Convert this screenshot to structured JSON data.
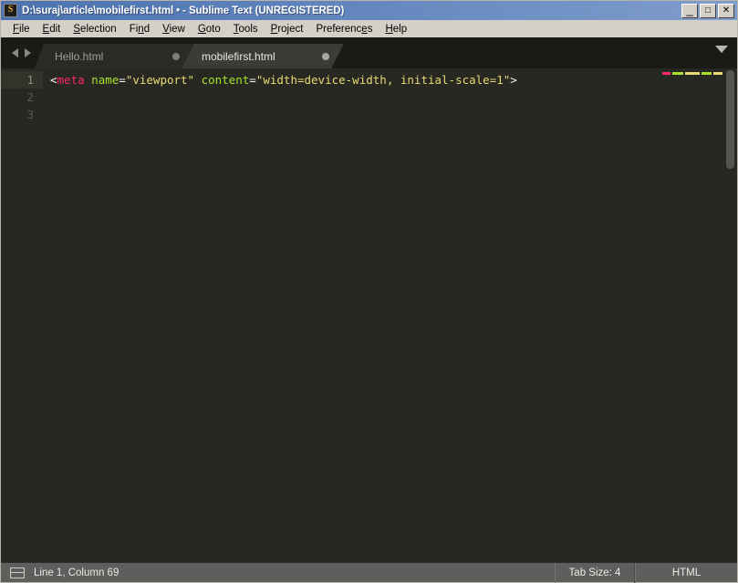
{
  "window": {
    "title": "D:\\suraj\\article\\mobilefirst.html • - Sublime Text (UNREGISTERED)",
    "app_icon": "sublime-text-icon",
    "controls": {
      "minimize": "_",
      "maximize": "□",
      "close": "✕"
    }
  },
  "menubar": {
    "items": [
      {
        "label": "File",
        "mnemonic_index": 0
      },
      {
        "label": "Edit",
        "mnemonic_index": 0
      },
      {
        "label": "Selection",
        "mnemonic_index": 0
      },
      {
        "label": "Find",
        "mnemonic_index": 2
      },
      {
        "label": "View",
        "mnemonic_index": 0
      },
      {
        "label": "Goto",
        "mnemonic_index": 0
      },
      {
        "label": "Tools",
        "mnemonic_index": 0
      },
      {
        "label": "Project",
        "mnemonic_index": 0
      },
      {
        "label": "Preferences",
        "mnemonic_index": 9
      },
      {
        "label": "Help",
        "mnemonic_index": 0
      }
    ]
  },
  "tabbar": {
    "nav_prev_icon": "arrow-left-icon",
    "nav_next_icon": "arrow-right-icon",
    "menu_icon": "chevron-down-icon",
    "tabs": [
      {
        "label": "Hello.html",
        "active": false,
        "dirty": true
      },
      {
        "label": "mobilefirst.html",
        "active": true,
        "dirty": true
      }
    ]
  },
  "editor": {
    "line_numbers": [
      "1",
      "2",
      "3"
    ],
    "active_line": 1,
    "lines": [
      {
        "number": "1",
        "tokens": [
          {
            "text": "<",
            "type": "punct"
          },
          {
            "text": "meta",
            "type": "tag"
          },
          {
            "text": " ",
            "type": "punct"
          },
          {
            "text": "name",
            "type": "attr"
          },
          {
            "text": "=",
            "type": "punct"
          },
          {
            "text": "\"viewport\"",
            "type": "str"
          },
          {
            "text": " ",
            "type": "punct"
          },
          {
            "text": "content",
            "type": "attr"
          },
          {
            "text": "=",
            "type": "punct"
          },
          {
            "text": "\"width=device-width, initial-scale=1\"",
            "type": "str"
          },
          {
            "text": ">",
            "type": "punct"
          }
        ]
      },
      {
        "number": "2",
        "tokens": []
      },
      {
        "number": "3",
        "tokens": []
      }
    ],
    "minimap": {
      "rows": [
        [
          {
            "color": "#f92672",
            "width": 9
          },
          {
            "color": "#a6e22e",
            "width": 12
          },
          {
            "color": "#e6db74",
            "width": 16
          },
          {
            "color": "#a6e22e",
            "width": 11
          },
          {
            "color": "#e6db74",
            "width": 10
          }
        ]
      ]
    },
    "scrollbar": "vertical-scrollbar"
  },
  "statusbar": {
    "split_icon": "split-pane-icon",
    "position": "Line 1, Column 69",
    "tab_size": "Tab Size: 4",
    "syntax": "HTML"
  },
  "colors": {
    "titlebar_start": "#4c73b0",
    "titlebar_end": "#7f9dcc",
    "chrome": "#d4d0c8",
    "editor_bg": "#272822",
    "tabbar_bg": "#1a1a17",
    "tab_active": "#3b3b38",
    "tab_inactive": "#2a2a27",
    "statusbar_bg": "#5e5e5c",
    "tag": "#f92672",
    "attr": "#a6e22e",
    "string": "#e6db74",
    "punct": "#f8f8f2"
  }
}
